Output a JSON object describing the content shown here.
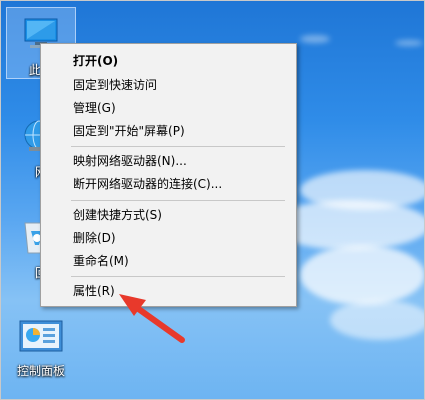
{
  "desktop": {
    "icons": [
      {
        "label": "此电"
      },
      {
        "label": "网"
      },
      {
        "label": "回"
      },
      {
        "label": "控制面板"
      }
    ]
  },
  "context_menu": {
    "groups": [
      [
        {
          "label": "打开(O)",
          "bold": true
        },
        {
          "label": "固定到快速访问"
        },
        {
          "label": "管理(G)"
        },
        {
          "label": "固定到\"开始\"屏幕(P)"
        }
      ],
      [
        {
          "label": "映射网络驱动器(N)..."
        },
        {
          "label": "断开网络驱动器的连接(C)..."
        }
      ],
      [
        {
          "label": "创建快捷方式(S)"
        },
        {
          "label": "删除(D)"
        },
        {
          "label": "重命名(M)"
        }
      ],
      [
        {
          "label": "属性(R)"
        }
      ]
    ]
  },
  "colors": {
    "sky": "#2f8ce8",
    "menu_bg": "#f2f2f2",
    "arrow": "#e8392b"
  },
  "annotation": {
    "icon": "red-arrow-icon"
  }
}
